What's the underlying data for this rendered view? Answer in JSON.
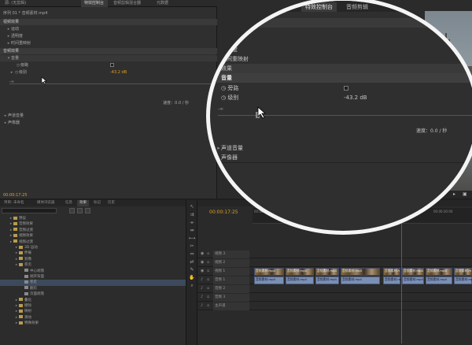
{
  "top_tabs": [
    {
      "label": "源: (无剪辑)",
      "active": false
    },
    {
      "label": "特效控制台",
      "active": true
    },
    {
      "label": "音频剪辑混合器",
      "active": false
    },
    {
      "label": "元数据",
      "active": false
    }
  ],
  "effect_controls": {
    "clip_header": "序列 01 * 音频素材.mp4",
    "rows": [
      {
        "kind": "section",
        "label": "视频效果"
      },
      {
        "kind": "prop",
        "label": "运动",
        "indent": 1
      },
      {
        "kind": "prop",
        "label": "透明度",
        "indent": 1
      },
      {
        "kind": "prop",
        "label": "时间重映射",
        "indent": 1
      },
      {
        "kind": "section",
        "label": "音频效果"
      },
      {
        "kind": "prop",
        "label": "音量",
        "indent": 1
      },
      {
        "kind": "prop",
        "label": "旁路",
        "indent": 2
      },
      {
        "kind": "prop",
        "label": "级别",
        "indent": 2,
        "value": "-43.2 dB"
      }
    ],
    "slider_min": "-∞",
    "speed_readout": "速度：0.0 / 秒",
    "rows_bottom": [
      {
        "label": "声道音量"
      },
      {
        "label": "声像器"
      }
    ],
    "timecode": "00:00:17:25"
  },
  "zoom": {
    "tabs": [
      {
        "label": "特效控制台",
        "active": true
      },
      {
        "label": "音频剪辑",
        "active": false
      }
    ],
    "sub_header": "音频素材",
    "labels": {
      "motion": "运动",
      "opacity": "透明度",
      "time_remap": "时间重映射",
      "audio_fx_header": "效果",
      "volume": "音量",
      "bypass": "旁路",
      "level": "级别",
      "level_value": "-43.2 dB",
      "slider_min": "-∞",
      "speed": "速度：0.0 / 秒",
      "channel_volume": "声道音量",
      "panner": "声像器"
    }
  },
  "project_panel": {
    "tabs": [
      {
        "label": "项目: 未命名",
        "active": false
      },
      {
        "label": "媒体浏览器",
        "active": false
      },
      {
        "label": "信息",
        "active": false
      },
      {
        "label": "效果",
        "active": true
      },
      {
        "label": "标记",
        "active": false
      },
      {
        "label": "历史",
        "active": false
      }
    ],
    "items": [
      {
        "label": "预设",
        "indent": 1,
        "selected": false
      },
      {
        "label": "音频效果",
        "indent": 1,
        "selected": false
      },
      {
        "label": "音频过渡",
        "indent": 1,
        "selected": false
      },
      {
        "label": "视频效果",
        "indent": 1,
        "selected": false
      },
      {
        "label": "视频过渡",
        "indent": 1,
        "selected": false
      },
      {
        "label": "3D 运动",
        "indent": 2,
        "selected": false
      },
      {
        "label": "伸展",
        "indent": 2,
        "selected": false
      },
      {
        "label": "划像",
        "indent": 2,
        "selected": false
      },
      {
        "label": "卷页",
        "indent": 2,
        "selected": false
      },
      {
        "label": "中心剥落",
        "indent": 3,
        "selected": false
      },
      {
        "label": "剥开背面",
        "indent": 3,
        "selected": false
      },
      {
        "label": "卷走",
        "indent": 3,
        "selected": true
      },
      {
        "label": "翻页",
        "indent": 3,
        "selected": false
      },
      {
        "label": "页面剥落",
        "indent": 3,
        "selected": false
      },
      {
        "label": "叠化",
        "indent": 2,
        "selected": false
      },
      {
        "label": "擦除",
        "indent": 2,
        "selected": false
      },
      {
        "label": "映射",
        "indent": 2,
        "selected": false
      },
      {
        "label": "滑动",
        "indent": 2,
        "selected": false
      },
      {
        "label": "特殊效果",
        "indent": 2,
        "selected": false
      }
    ]
  },
  "sequence": {
    "timecode": "00:00:17:25",
    "ruler_labels": [
      "00:00",
      "00:00:15:00",
      "00:00:30:00"
    ],
    "tracks": [
      {
        "label": "视频 3",
        "type": "video"
      },
      {
        "label": "视频 2",
        "type": "video"
      },
      {
        "label": "视频 1",
        "type": "video",
        "clips": true
      },
      {
        "label": "音频 1",
        "type": "audio",
        "clips": true
      },
      {
        "label": "音频 2",
        "type": "audio"
      },
      {
        "label": "音频 3",
        "type": "audio"
      },
      {
        "label": "主声道",
        "type": "master"
      }
    ],
    "clip_name": "音频素材.mp4"
  }
}
